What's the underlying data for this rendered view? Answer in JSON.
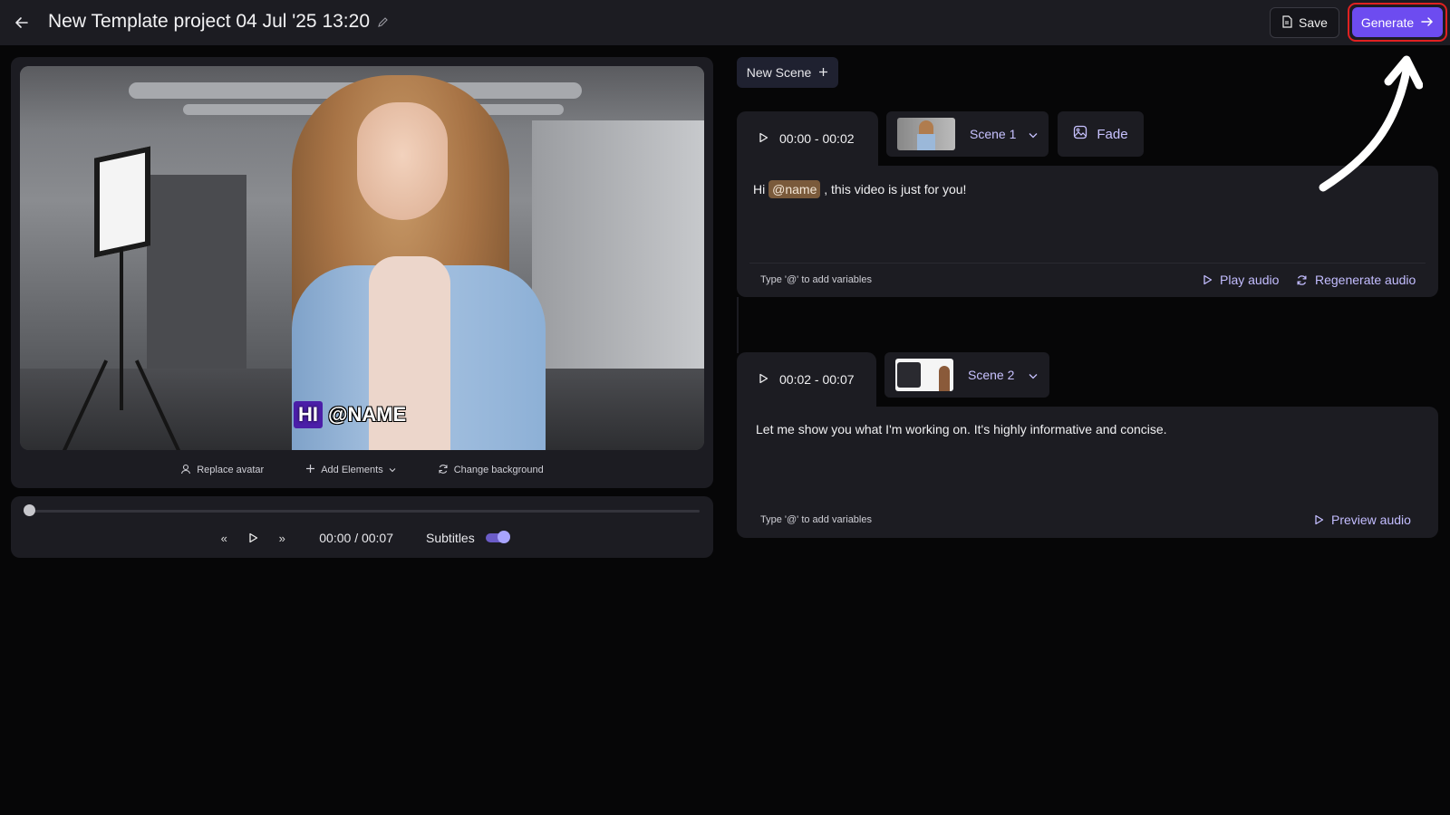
{
  "header": {
    "title": "New Template project 04 Jul '25 13:20",
    "save_label": "Save",
    "generate_label": "Generate"
  },
  "preview": {
    "caption_hi": "HI",
    "caption_name": "@NAME",
    "tools": {
      "replace_avatar": "Replace avatar",
      "add_elements": "Add Elements",
      "change_background": "Change background"
    }
  },
  "playback": {
    "progress": 0,
    "time": "00:00 / 00:07",
    "subtitles_label": "Subtitles",
    "subtitles_on": true
  },
  "scenes": {
    "new_scene_label": "New Scene",
    "items": [
      {
        "time_range": "00:00 - 00:02",
        "scene_label": "Scene 1",
        "transition_label": "Fade",
        "script_before": "Hi",
        "script_variable": "@name",
        "script_after": ", this video is just for you!",
        "hint": "Type '@' to add variables",
        "play_audio_label": "Play audio",
        "regenerate_audio_label": "Regenerate audio"
      },
      {
        "time_range": "00:02 - 00:07",
        "scene_label": "Scene 2",
        "script": "Let me show you what I'm working on. It's highly informative and concise.",
        "hint": "Type '@' to add variables",
        "preview_audio_label": "Preview audio"
      }
    ]
  },
  "colors": {
    "accent": "#6d4cf0",
    "highlight": "#e02121",
    "link": "#c3bdff"
  }
}
